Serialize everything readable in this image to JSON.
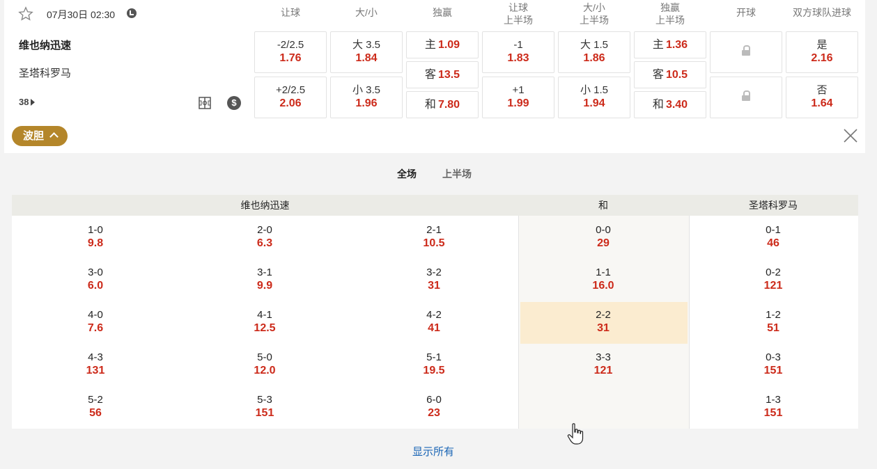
{
  "match": {
    "datetime": "07月30日 02:30",
    "home": "维也纳迅速",
    "away": "圣塔科罗马",
    "market_count": "38"
  },
  "columns": [
    "让球",
    "大/小",
    "独赢",
    "让球\n上半场",
    "大/小\n上半场",
    "独赢\n上半场",
    "开球",
    "双方球队进球"
  ],
  "odds": {
    "handicap": [
      {
        "line": "-2/2.5",
        "odd": "1.76"
      },
      {
        "line": "+2/2.5",
        "odd": "2.06"
      }
    ],
    "over_under": [
      {
        "line": "大 3.5",
        "odd": "1.84"
      },
      {
        "line": "小 3.5",
        "odd": "1.96"
      }
    ],
    "moneyline": [
      {
        "label": "主",
        "odd": "1.09"
      },
      {
        "label": "客",
        "odd": "13.5"
      },
      {
        "label": "和",
        "odd": "7.80"
      }
    ],
    "handicap_1h": [
      {
        "line": "-1",
        "odd": "1.83"
      },
      {
        "line": "+1",
        "odd": "1.99"
      }
    ],
    "over_under_1h": [
      {
        "line": "大 1.5",
        "odd": "1.86"
      },
      {
        "line": "小 1.5",
        "odd": "1.94"
      }
    ],
    "moneyline_1h": [
      {
        "label": "主",
        "odd": "1.36"
      },
      {
        "label": "客",
        "odd": "10.5"
      },
      {
        "label": "和",
        "odd": "3.40"
      }
    ],
    "btts": [
      {
        "label": "是",
        "odd": "2.16"
      },
      {
        "label": "否",
        "odd": "1.64"
      }
    ]
  },
  "correct_score": {
    "toggle_label": "波胆",
    "tabs": [
      "全场",
      "上半场"
    ],
    "headers": {
      "home": "维也纳迅速",
      "draw": "和",
      "away": "圣塔科罗马"
    },
    "home_cols": [
      [
        {
          "s": "1-0",
          "o": "9.8"
        },
        {
          "s": "3-0",
          "o": "6.0"
        },
        {
          "s": "4-0",
          "o": "7.6"
        },
        {
          "s": "4-3",
          "o": "131"
        },
        {
          "s": "5-2",
          "o": "56"
        }
      ],
      [
        {
          "s": "2-0",
          "o": "6.3"
        },
        {
          "s": "3-1",
          "o": "9.9"
        },
        {
          "s": "4-1",
          "o": "12.5"
        },
        {
          "s": "5-0",
          "o": "12.0"
        },
        {
          "s": "5-3",
          "o": "151"
        }
      ],
      [
        {
          "s": "2-1",
          "o": "10.5"
        },
        {
          "s": "3-2",
          "o": "31"
        },
        {
          "s": "4-2",
          "o": "41"
        },
        {
          "s": "5-1",
          "o": "19.5"
        },
        {
          "s": "6-0",
          "o": "23"
        }
      ]
    ],
    "draw": [
      {
        "s": "0-0",
        "o": "29"
      },
      {
        "s": "1-1",
        "o": "16.0"
      },
      {
        "s": "2-2",
        "o": "31"
      },
      {
        "s": "3-3",
        "o": "121"
      }
    ],
    "away": [
      {
        "s": "0-1",
        "o": "46"
      },
      {
        "s": "0-2",
        "o": "121"
      },
      {
        "s": "1-2",
        "o": "51"
      },
      {
        "s": "0-3",
        "o": "151"
      },
      {
        "s": "1-3",
        "o": "151"
      }
    ],
    "show_all": "显示所有"
  },
  "colors": {
    "odds": "#cc2a1a",
    "accent": "#b4862a",
    "link": "#1a65b5",
    "highlight": "#fbecd0"
  }
}
